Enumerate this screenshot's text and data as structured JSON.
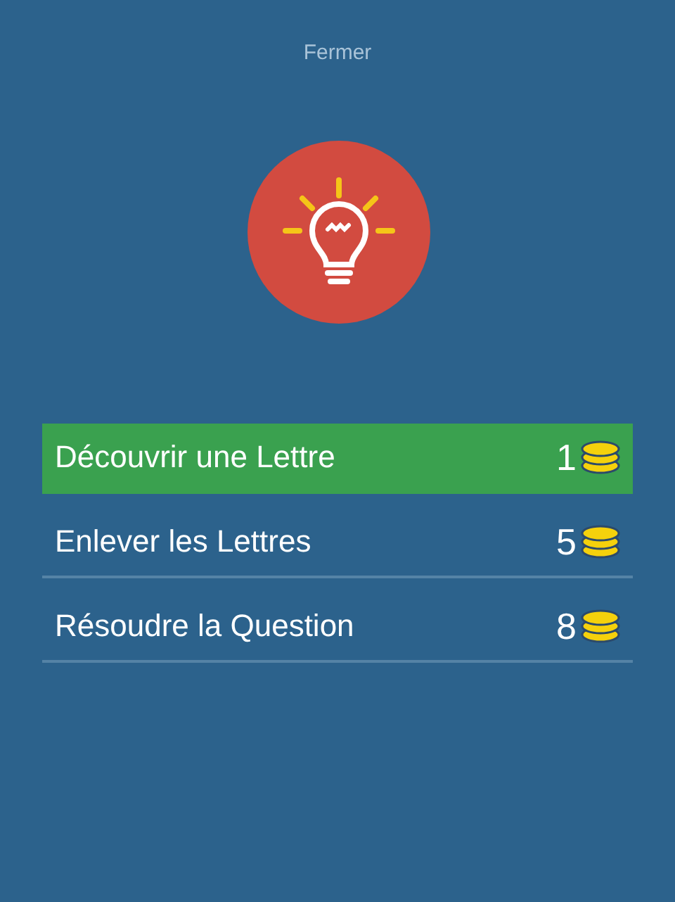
{
  "close_label": "Fermer",
  "options": [
    {
      "label": "Découvrir une Lettre",
      "cost": "1",
      "selected": true
    },
    {
      "label": "Enlever les Lettres",
      "cost": "5",
      "selected": false
    },
    {
      "label": "Résoudre la Question",
      "cost": "8",
      "selected": false
    }
  ]
}
